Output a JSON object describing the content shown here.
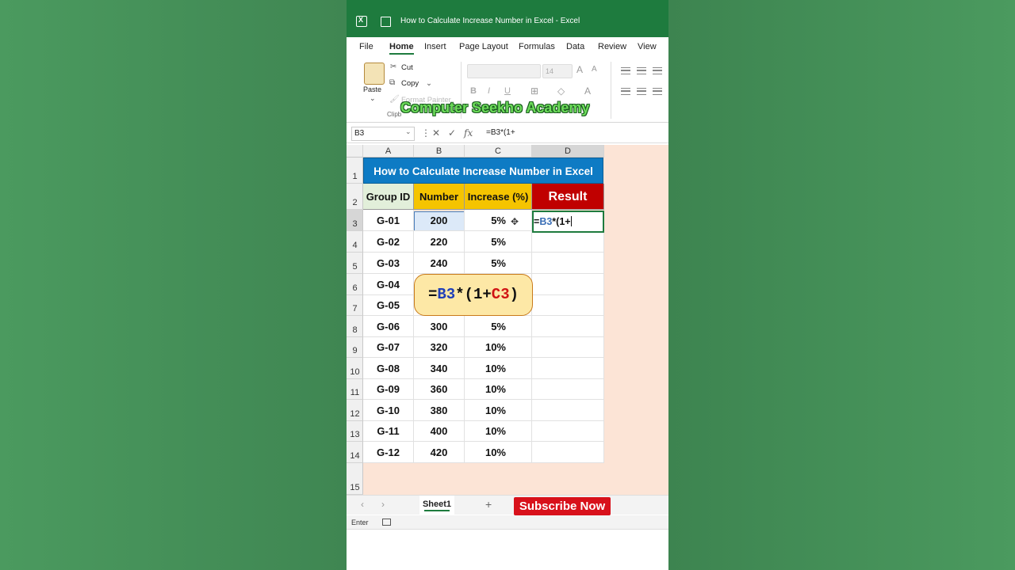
{
  "window": {
    "title": "How to Calculate Increase Number in Excel  -  Excel"
  },
  "menu": [
    "File",
    "Home",
    "Insert",
    "Page Layout",
    "Formulas",
    "Data",
    "Review",
    "View"
  ],
  "menu_active": "Home",
  "ribbon": {
    "paste": "Paste",
    "cut": "Cut",
    "copy": "Copy",
    "format_painter": "Format Painter",
    "clipboard_group": "Clipb",
    "font_size": "14",
    "bold": "B",
    "italic": "I",
    "underline": "U"
  },
  "watermark": "Computer Seekho Academy",
  "formula_bar": {
    "name_box": "B3",
    "fx": "fx",
    "formula": "=B3*(1+"
  },
  "columns": [
    "A",
    "B",
    "C",
    "D"
  ],
  "rows": [
    "1",
    "2",
    "3",
    "4",
    "5",
    "6",
    "7",
    "8",
    "9",
    "10",
    "11",
    "12",
    "13",
    "14",
    "15"
  ],
  "sheet": {
    "title": "How to Calculate Increase Number in Excel",
    "headers": {
      "group": "Group ID",
      "number": "Number",
      "increase": "Increase (%)",
      "result": "Result"
    },
    "data": [
      {
        "group": "G-01",
        "number": "200",
        "increase": "5%"
      },
      {
        "group": "G-02",
        "number": "220",
        "increase": "5%"
      },
      {
        "group": "G-03",
        "number": "240",
        "increase": "5%"
      },
      {
        "group": "G-04",
        "number": "",
        "increase": ""
      },
      {
        "group": "G-05",
        "number": "",
        "increase": ""
      },
      {
        "group": "G-06",
        "number": "300",
        "increase": "5%"
      },
      {
        "group": "G-07",
        "number": "320",
        "increase": "10%"
      },
      {
        "group": "G-08",
        "number": "340",
        "increase": "10%"
      },
      {
        "group": "G-09",
        "number": "360",
        "increase": "10%"
      },
      {
        "group": "G-10",
        "number": "380",
        "increase": "10%"
      },
      {
        "group": "G-11",
        "number": "400",
        "increase": "10%"
      },
      {
        "group": "G-12",
        "number": "420",
        "increase": "10%"
      }
    ]
  },
  "editing": {
    "eq": "=",
    "ref1": "B3",
    "rest": "*(1+"
  },
  "callout": {
    "eq": "=",
    "ref1": "B3",
    "mid": "*(1+",
    "ref2": "C3",
    "close": ")"
  },
  "tabs": {
    "sheet": "Sheet1",
    "add": "+",
    "prev": "‹",
    "next": "›"
  },
  "subscribe": "Subscribe Now",
  "status": "Enter",
  "colors": {
    "title_bar": "#1e7b3e",
    "title_cell": "#0e7bc4",
    "header_group": "#e2efda",
    "header_number": "#f5c400",
    "header_increase": "#f5c400",
    "header_result": "#c00000",
    "callout_bg": "#fde8a6",
    "ref1": "#1f3fb8",
    "ref2": "#d01414",
    "subscribe": "#d8111b"
  }
}
